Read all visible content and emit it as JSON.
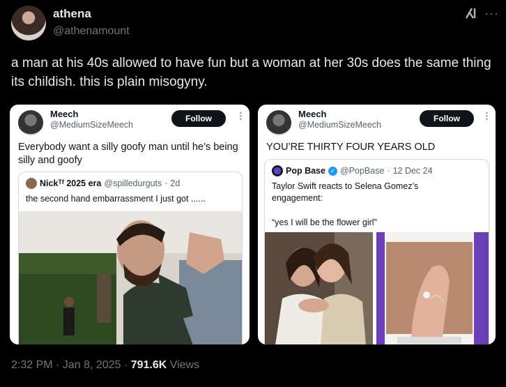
{
  "post": {
    "author_name": "athena",
    "author_handle": "@athenamount",
    "text": "a man at his 40s allowed to have fun but a woman at her 30s does the same thing its childish. this is plain misogyny.",
    "time": "2:32 PM",
    "date": "Jan 8, 2025",
    "views_count": "791.6K",
    "views_label": "Views",
    "separator": "·"
  },
  "left_card": {
    "name": "Meech",
    "handle": "@MediumSizeMeech",
    "follow_label": "Follow",
    "text": "Everybody want a silly goofy man until he’s being silly and goofy",
    "quote": {
      "name": "Nickᵀᶠ 2025 era",
      "handle": "@spilledurguts",
      "age": "2d",
      "text": "the second hand embarrassment I just got ......"
    }
  },
  "right_card": {
    "name": "Meech",
    "handle": "@MediumSizeMeech",
    "follow_label": "Follow",
    "text": "YOU’RE THIRTY FOUR YEARS OLD",
    "quote": {
      "name": "Pop Base",
      "handle": "@PopBase",
      "date": "12 Dec 24",
      "line1": "Taylor Swift reacts to Selena Gomez’s",
      "line2": "engagement:",
      "line3": "“yes I will be the flower girl”"
    }
  },
  "icons": {
    "more": "more-icon",
    "grok": "grok-icon",
    "verified": "verified-icon"
  },
  "colors": {
    "background": "#000000",
    "primary_text": "#e7e9ea",
    "secondary_text": "#71767b",
    "verified_blue": "#1d9bf0"
  }
}
